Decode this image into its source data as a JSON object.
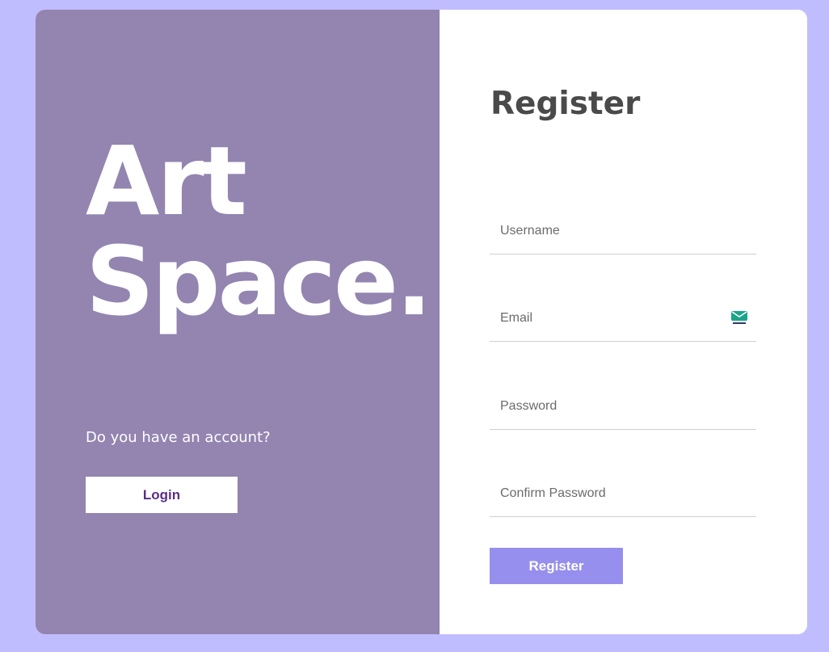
{
  "brand": {
    "line1": "Art",
    "line2": "Space."
  },
  "left": {
    "question": "Do you have an account?",
    "login_label": "Login"
  },
  "form": {
    "title": "Register",
    "username_placeholder": "Username",
    "email_placeholder": "Email",
    "password_placeholder": "Password",
    "confirm_placeholder": "Confirm Password",
    "submit_label": "Register",
    "email_icon": "tempmail-envelope-icon"
  },
  "colors": {
    "page_background": "#c0bdff",
    "left_panel": "#9384b0",
    "register_button": "#968fee",
    "login_text": "#5b2e85"
  }
}
